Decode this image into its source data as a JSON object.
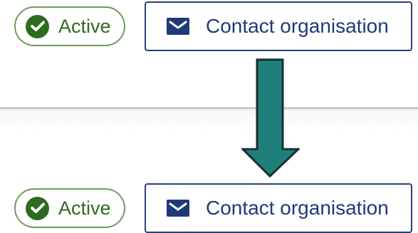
{
  "before": {
    "status_badge": {
      "label": "Active",
      "icon": "check-circle-icon"
    },
    "contact_button": {
      "label": "Contact organisation",
      "icon": "envelope-icon"
    }
  },
  "after": {
    "status_badge": {
      "label": "Active",
      "icon": "check-circle-icon"
    },
    "contact_button": {
      "label": "Contact organisation",
      "icon": "envelope-icon"
    }
  },
  "arrow": {
    "direction": "down",
    "color": "#1e7f7a"
  },
  "colors": {
    "badge_green": "#2d6b1f",
    "badge_border": "#6f9a5e",
    "button_blue": "#1f3a7a",
    "button_border": "#2a3f7a"
  }
}
